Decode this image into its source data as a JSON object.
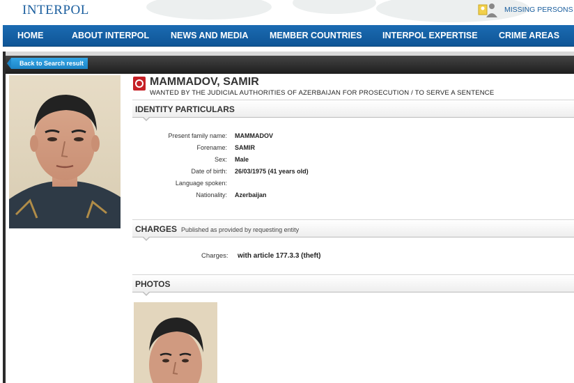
{
  "header": {
    "logo_text": "INTERPOL",
    "missing_persons": "MISSING PERSONS"
  },
  "nav": {
    "items": [
      "HOME",
      "ABOUT INTERPOL",
      "NEWS AND MEDIA",
      "MEMBER COUNTRIES",
      "INTERPOL EXPERTISE",
      "CRIME AREAS"
    ]
  },
  "back_button": "Back to Search result",
  "notice": {
    "name": "MAMMADOV, SAMIR",
    "wanted_by": "WANTED BY THE JUDICIAL AUTHORITIES OF AZERBAIJAN FOR PROSECUTION / TO SERVE A SENTENCE"
  },
  "identity": {
    "title": "IDENTITY PARTICULARS",
    "rows": [
      {
        "label": "Present family name:",
        "value": "MAMMADOV"
      },
      {
        "label": "Forename:",
        "value": "SAMIR"
      },
      {
        "label": "Sex:",
        "value": "Male"
      },
      {
        "label": "Date of birth:",
        "value": "26/03/1975 (41 years old)"
      },
      {
        "label": "Language spoken:",
        "value": ""
      },
      {
        "label": "Nationality:",
        "value": "Azerbaijan"
      }
    ]
  },
  "charges": {
    "title": "CHARGES",
    "subtitle": "Published as provided by requesting entity",
    "label": "Charges:",
    "value": "with article 177.3.3 (theft)"
  },
  "photos": {
    "title": "PHOTOS"
  },
  "colors": {
    "nav_blue": "#1565ab",
    "link_blue": "#1a5e9e",
    "notice_red": "#c62127"
  }
}
